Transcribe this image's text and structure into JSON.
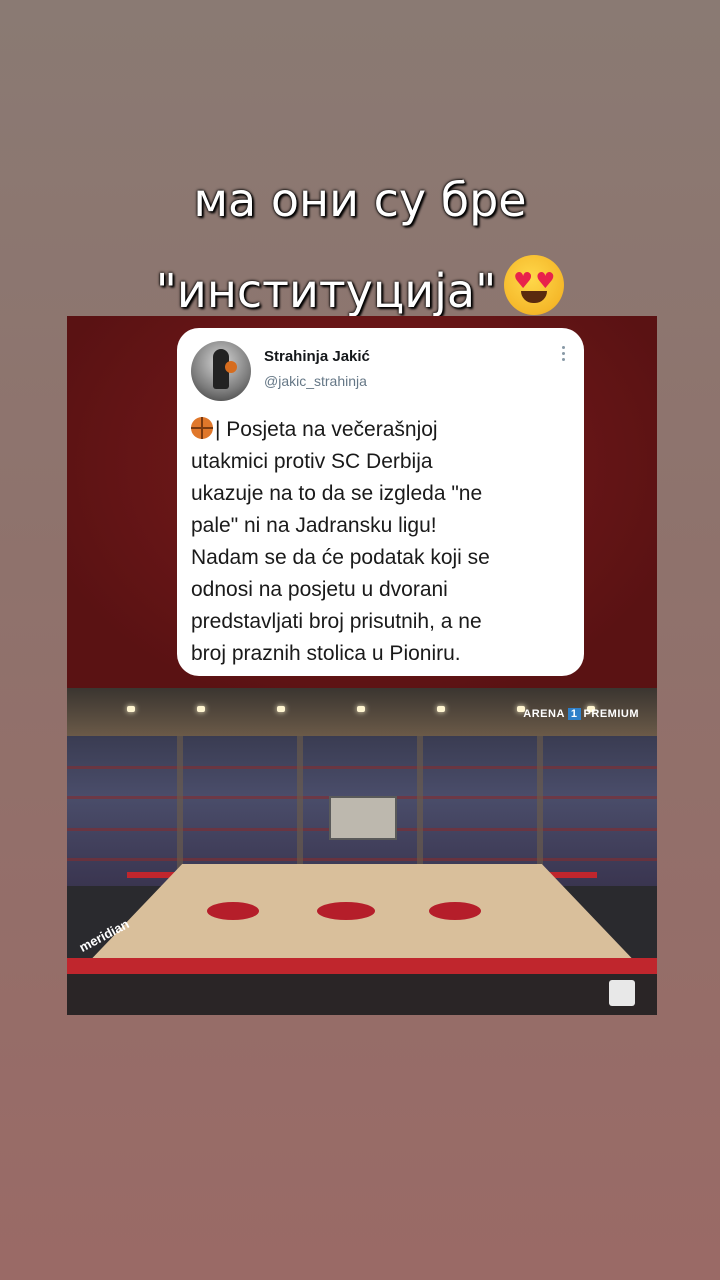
{
  "caption": {
    "line1": "ма они су бре",
    "line2": "\"институција\"",
    "emoji": "smiling-face-with-heart-eyes"
  },
  "tweet": {
    "name": "Strahinja Jakić",
    "handle": "@jakic_strahinja",
    "text": "| Posjeta na večerašnjoj\nutakmici protiv SC Derbija\nukazuje na to da se izgleda \"ne\npale\" ni na Jadransku ligu!\nNadam se da će podatak koji se\nodnosi na posjetu u dvorani\npredstavljati broj prisutnih, a ne\nbroj praznih stolica u Pioniru."
  },
  "broadcast": {
    "badge_left": "ARENA",
    "badge_num": "1",
    "badge_right": "PREMIUM",
    "court_logo": "mts",
    "ad": "meridian"
  }
}
